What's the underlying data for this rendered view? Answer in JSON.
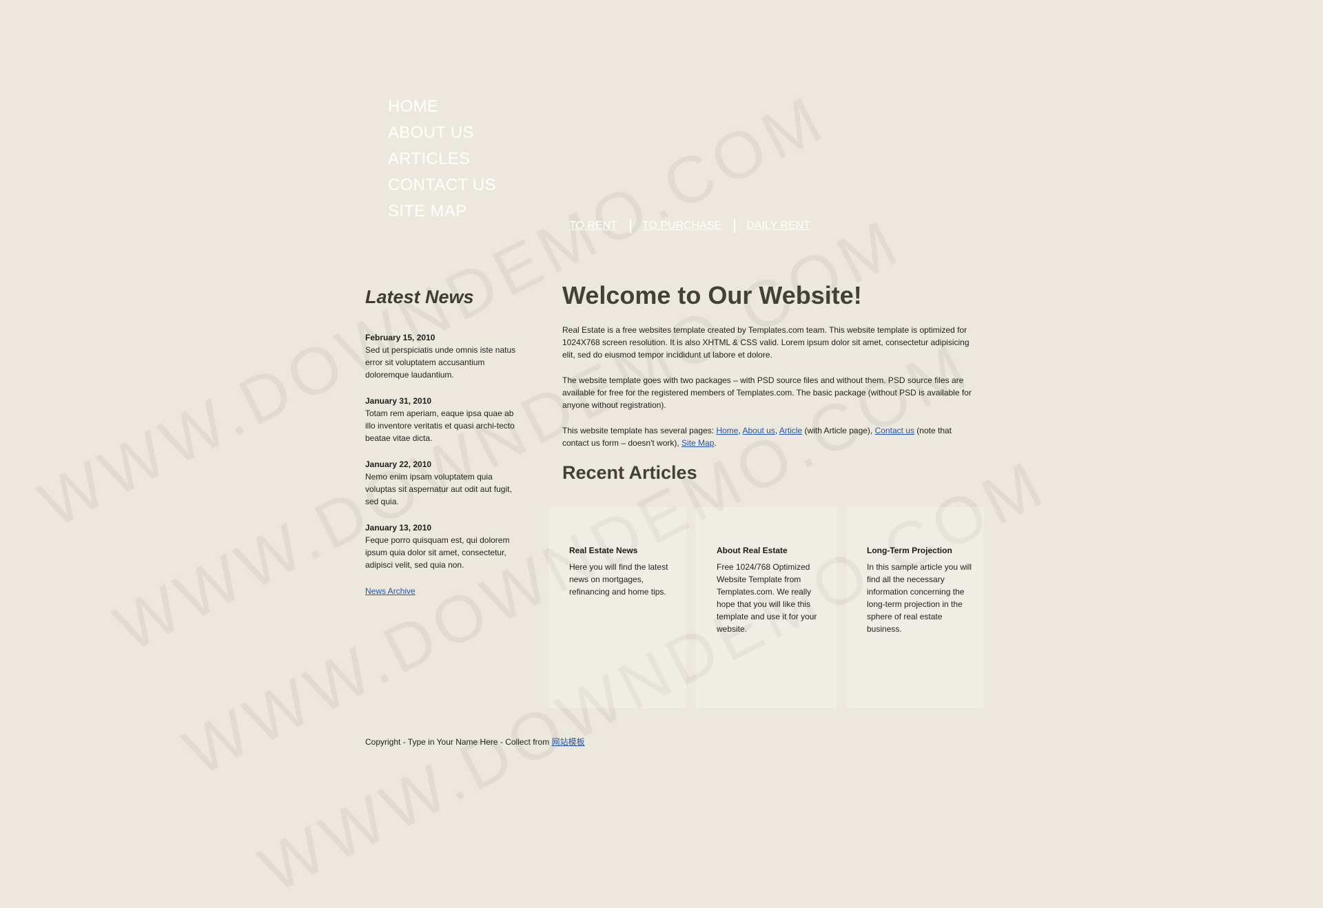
{
  "main_nav": [
    "HOME",
    "ABOUT US",
    "ARTICLES",
    "CONTACT US",
    "SITE MAP"
  ],
  "sub_nav": [
    "TO RENT",
    "TO PURCHASE",
    "DAILY RENT"
  ],
  "news": {
    "title": "Latest News",
    "items": [
      {
        "date": "February 15, 2010",
        "text": "Sed ut perspiciatis unde omnis iste natus error sit voluptatem accusantium doloremque laudantium."
      },
      {
        "date": "January 31, 2010",
        "text": "Totam rem aperiam, eaque ipsa quae ab illo inventore veritatis et quasi archi-tecto beatae vitae dicta."
      },
      {
        "date": "January 22, 2010",
        "text": "Nemo enim ipsam voluptatem quia voluptas sit aspernatur aut odit aut fugit, sed quia."
      },
      {
        "date": "January 13, 2010",
        "text": "Feque porro quisquam est, qui dolorem ipsum quia dolor sit amet, consectetur, adipisci velit, sed quia non."
      }
    ],
    "archive": "News Archive"
  },
  "content": {
    "title": "Welcome to Our Website!",
    "p1": "Real Estate is a free websites template created by Templates.com team. This website template is optimized for 1024X768 screen resolution. It is also XHTML & CSS valid. Lorem ipsum dolor sit amet, consectetur adipisicing elit, sed do eiusmod tempor incididunt ut labore et dolore.",
    "p2": "The website template goes with two packages – with PSD source files and without them. PSD source files are available for free for the registered members of Templates.com. The basic package (without PSD is available for anyone without registration).",
    "p3": {
      "lead": "This website template has several pages: ",
      "home": "Home",
      "comma1": ", ",
      "about": "About us",
      "comma2": ", ",
      "article": "Article",
      "mid": " (with Article page), ",
      "contact": "Contact us",
      "tail": " (note that contact us form – doesn't work), ",
      "sitemap": "Site Map",
      "end": "."
    },
    "recent_title": "Recent Articles"
  },
  "articles": [
    {
      "title": "Real Estate News",
      "text": "Here you will find the latest news on mortgages, refinancing and home tips."
    },
    {
      "title": "About Real Estate",
      "text": "Free 1024/768 Optimized Website Template from Templates.com. We really hope that you will like this template and use it for your website."
    },
    {
      "title": "Long-Term Projection",
      "text": "In this sample article you will find all the necessary information concerning the long-term projection in the sphere of real estate business."
    }
  ],
  "footer": {
    "text": "Copyright - Type in Your Name Here - Collect from ",
    "link": "网站模板"
  },
  "watermark": "WWW.DOWNDEMO.COM"
}
